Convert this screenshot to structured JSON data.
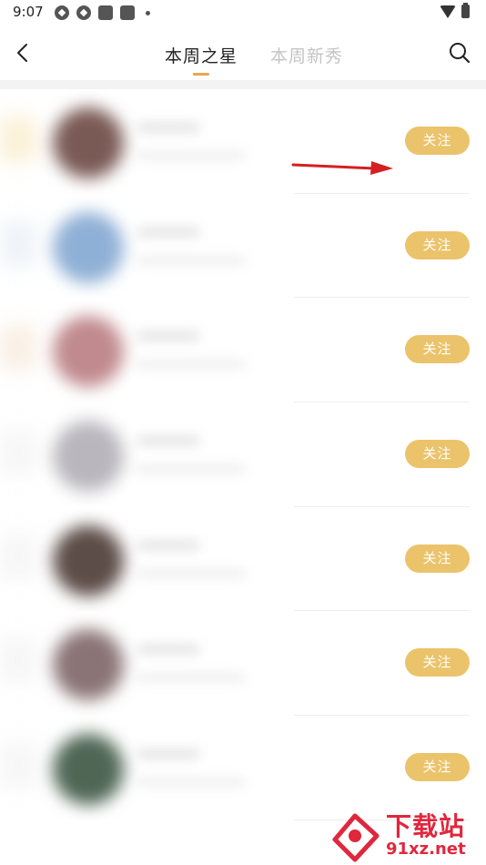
{
  "status_bar": {
    "time": "9:07",
    "icons": [
      "app-notification-icon",
      "app-notification-icon",
      "square-notification-icon",
      "square-notification-icon",
      "dot-icon",
      "wifi-icon",
      "battery-icon"
    ]
  },
  "header": {
    "tabs": [
      {
        "label": "本周之星",
        "active": true
      },
      {
        "label": "本周新秀",
        "active": false
      }
    ],
    "icons": {
      "back": "chevron-left-icon",
      "search": "search-icon"
    }
  },
  "list": {
    "items": [
      {
        "follow_label": "关注",
        "avatar_color": "#7a5a55",
        "tint": "#f7e3b0"
      },
      {
        "follow_label": "关注",
        "avatar_color": "#8fb0d6",
        "tint": "#dfe8f2"
      },
      {
        "follow_label": "关注",
        "avatar_color": "#c08a8e",
        "tint": "#f5e0cc"
      },
      {
        "follow_label": "关注",
        "avatar_color": "#b9b7bd",
        "tint": "#eeeeee"
      },
      {
        "follow_label": "关注",
        "avatar_color": "#5d4d48",
        "tint": "#eeeeee"
      },
      {
        "follow_label": "关注",
        "avatar_color": "#8a7476",
        "tint": "#eeeeee"
      },
      {
        "follow_label": "关注",
        "avatar_color": "#4f6655",
        "tint": "#eeeeee"
      }
    ]
  },
  "annotation": {
    "arrow_color": "#d42020"
  },
  "watermark": {
    "title": "下载站",
    "url": "91xz.net",
    "color": "#e0273d"
  },
  "colors": {
    "accent": "#e8a74c",
    "follow_button": "#ebc36b"
  }
}
